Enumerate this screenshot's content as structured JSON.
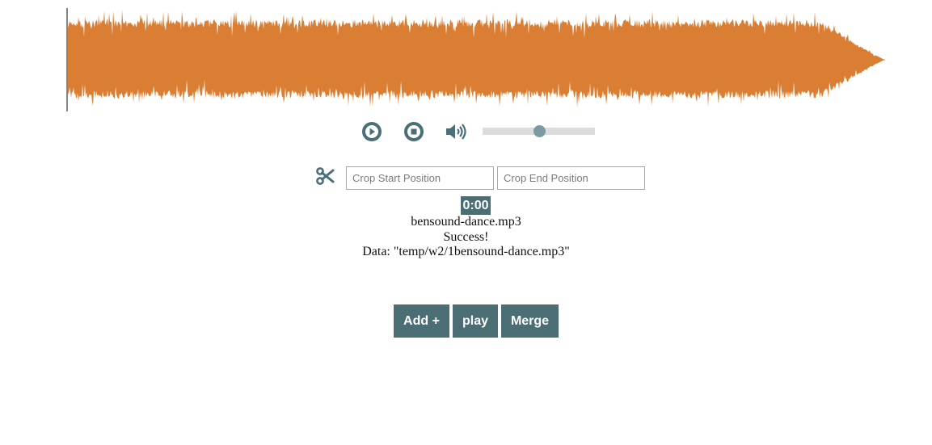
{
  "waveform": {
    "wave_color": "#d97e33",
    "cursor_color": "#333333",
    "progress": 0
  },
  "player": {
    "play_icon": "play-circle-icon",
    "stop_icon": "stop-circle-icon",
    "volume_icon": "volume-up-icon",
    "volume_level": 0.5,
    "icon_color": "#4a6f78"
  },
  "crop": {
    "icon": "scissors-icon",
    "start_placeholder": "Crop Start Position",
    "start_value": "",
    "end_placeholder": "Crop End Position",
    "end_value": ""
  },
  "status": {
    "current_time": "0:00",
    "filename": "bensound-dance.mp3",
    "message": "Success!",
    "data_line": "Data: \"temp/w2/1bensound-dance.mp3\""
  },
  "actions": {
    "add_label": "Add +",
    "play_label": "play",
    "merge_label": "Merge",
    "button_color": "#4a6e74"
  }
}
